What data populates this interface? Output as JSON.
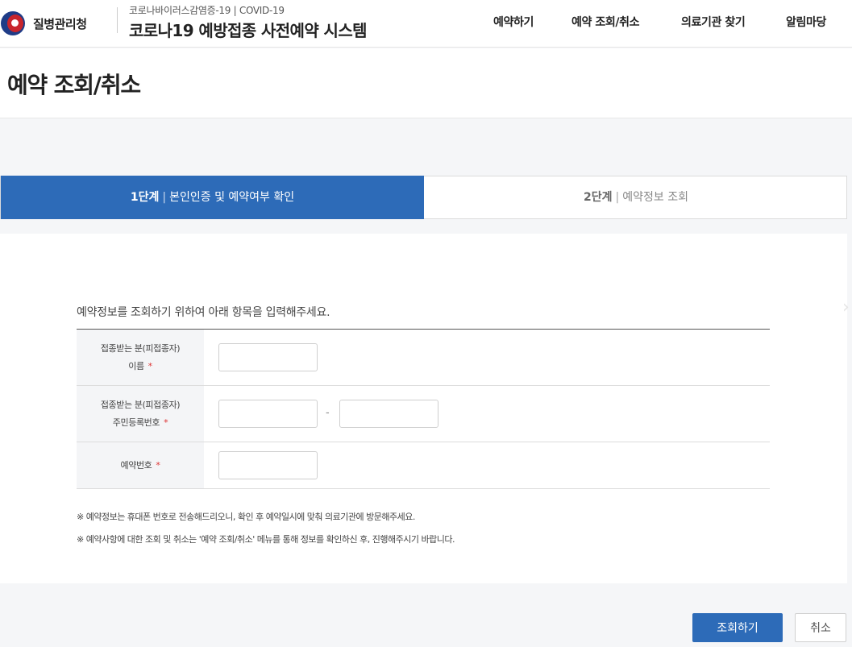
{
  "header": {
    "org_name": "질병관리청",
    "system_subtitle": "코로나바이러스감염증-19 | COVID-19",
    "system_title": "코로나19 예방접종 사전예약 시스템",
    "nav": [
      "예약하기",
      "예약 조회/취소",
      "의료기관 찾기",
      "알림마당"
    ]
  },
  "page": {
    "title": "예약 조회/취소"
  },
  "steps": [
    {
      "num": "1단계",
      "sep": "|",
      "label": "본인인증 및 예약여부 확인",
      "active": true
    },
    {
      "num": "2단계",
      "sep": "|",
      "label": "예약정보 조회",
      "active": false
    }
  ],
  "form": {
    "intro": "예약정보를 조회하기 위하여 아래 항목을 입력해주세요.",
    "required_mark": "*",
    "rows": [
      {
        "label_line1": "접종받는 분(피접종자)",
        "label_line2": "이름",
        "value": ""
      },
      {
        "label_line1": "접종받는 분(피접종자)",
        "label_line2": "주민등록번호",
        "value_front": "",
        "value_back": "",
        "separator": "-"
      },
      {
        "label_line1": "예약번호",
        "value": ""
      }
    ],
    "notes": [
      "※ 예약정보는 휴대폰 번호로 전송해드리오니, 확인 후 예약일시에 맞춰 의료기관에 방문해주세요.",
      "※ 예약사항에 대한 조회 및 취소는 '예약 조회/취소' 메뉴를 통해 정보를 확인하신 후, 진행해주시기 바랍니다."
    ]
  },
  "buttons": {
    "search": "조회하기",
    "cancel": "취소"
  },
  "colors": {
    "primary": "#2d6bb8",
    "required": "#dd3333",
    "logo_blue": "#1f3c87",
    "logo_red": "#c9252c"
  },
  "icons": {
    "side": "chevron-right-icon",
    "logo": "kdca-logo-icon"
  }
}
